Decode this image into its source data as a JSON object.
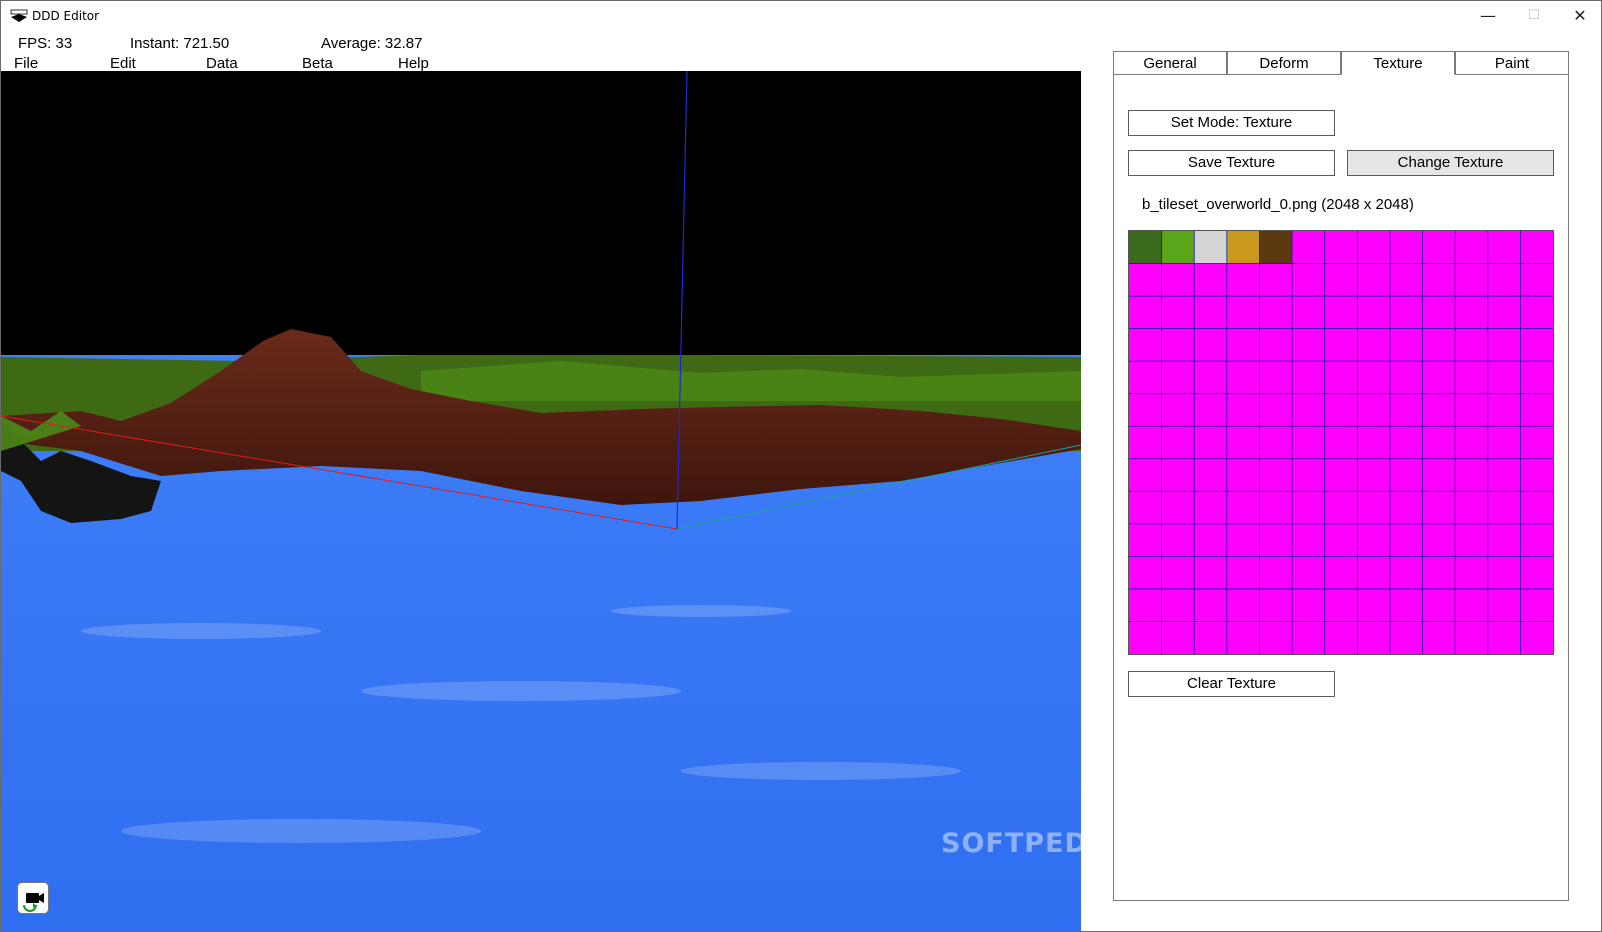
{
  "window": {
    "title": "DDD Editor",
    "icon": "ddd-app-icon"
  },
  "stats": {
    "fps": "FPS: 33",
    "instant": "Instant: 721.50",
    "average": "Average: 32.87"
  },
  "menu": {
    "items": [
      "File",
      "Edit",
      "Data",
      "Beta",
      "Help"
    ]
  },
  "tabs": [
    {
      "label": "General"
    },
    {
      "label": "Deform"
    },
    {
      "label": "Texture",
      "active": true
    },
    {
      "label": "Paint"
    }
  ],
  "texture": {
    "set_mode": "Set Mode: Texture",
    "save": "Save Texture",
    "change": "Change Texture",
    "file": "b_tileset_overworld_0.png (2048 x 2048)",
    "clear": "Clear Texture",
    "tiles": [
      "#3b6b1c",
      "#5aa519",
      "#d4d4d4",
      "#c9991e",
      "#5b3a12"
    ],
    "fill_color": "#ff00ff",
    "grid": {
      "cols": 13,
      "rows": 13
    }
  },
  "watermark": "SOFTPEDIA",
  "colors": {
    "sky": "#000000",
    "water": "#3b78f5",
    "terrain": "#5b2417",
    "grass": "#3f6a14"
  }
}
